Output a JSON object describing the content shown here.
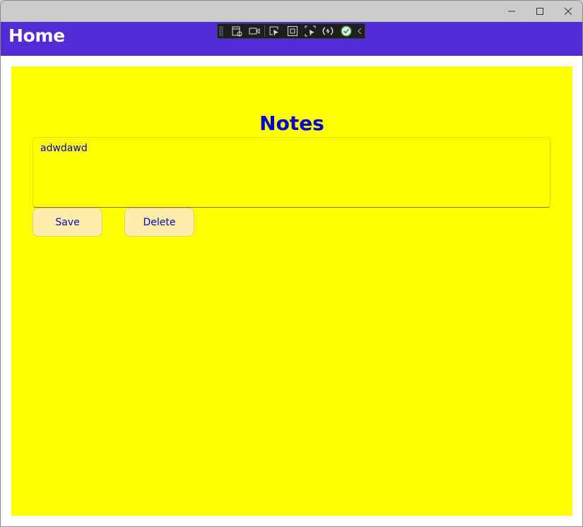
{
  "navbar": {
    "title": "Home",
    "color": "#512bd4"
  },
  "debug_toolbar": {
    "icons": [
      "live-visual-tree-icon",
      "record-icon",
      "select-element-icon",
      "display-layout-adorners-icon",
      "track-focus-icon",
      "hot-reload-icon",
      "binding-check-icon",
      "collapse-chevron-icon"
    ]
  },
  "page": {
    "background": "#ffff00",
    "heading": "Notes",
    "editor": {
      "value": "adwdawd"
    },
    "buttons": {
      "save_label": "Save",
      "delete_label": "Delete"
    }
  }
}
